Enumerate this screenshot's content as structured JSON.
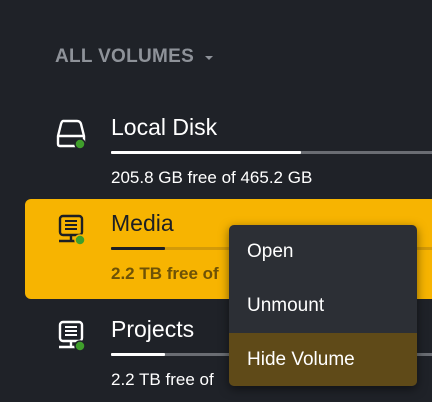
{
  "section": {
    "title": "ALL VOLUMES",
    "chevron_icon": "chevron-down-icon"
  },
  "volumes": [
    {
      "name": "Local Disk",
      "free_text": "205.8 GB free of 465.2 GB",
      "used_fraction": 0.56,
      "selected": false,
      "icon": "hard-drive-icon",
      "status_color": "#3f9e2b"
    },
    {
      "name": "Media",
      "free_text": "2.2 TB free of",
      "used_fraction": 0.16,
      "selected": true,
      "icon": "network-drive-icon",
      "status_color": "#3f9e2b"
    },
    {
      "name": "Projects",
      "free_text": "2.2 TB free of",
      "used_fraction": 0.16,
      "selected": false,
      "icon": "network-drive-icon",
      "status_color": "#3f9e2b"
    }
  ],
  "context_menu": {
    "items": [
      {
        "label": "Open",
        "highlighted": false
      },
      {
        "label": "Unmount",
        "highlighted": false
      },
      {
        "label": "Hide Volume",
        "highlighted": true
      }
    ]
  },
  "colors": {
    "background": "#1f2228",
    "accent": "#f7b401",
    "menu_background": "#2c2f35",
    "menu_highlight": "#5f4a18",
    "status_online": "#3f9e2b"
  }
}
